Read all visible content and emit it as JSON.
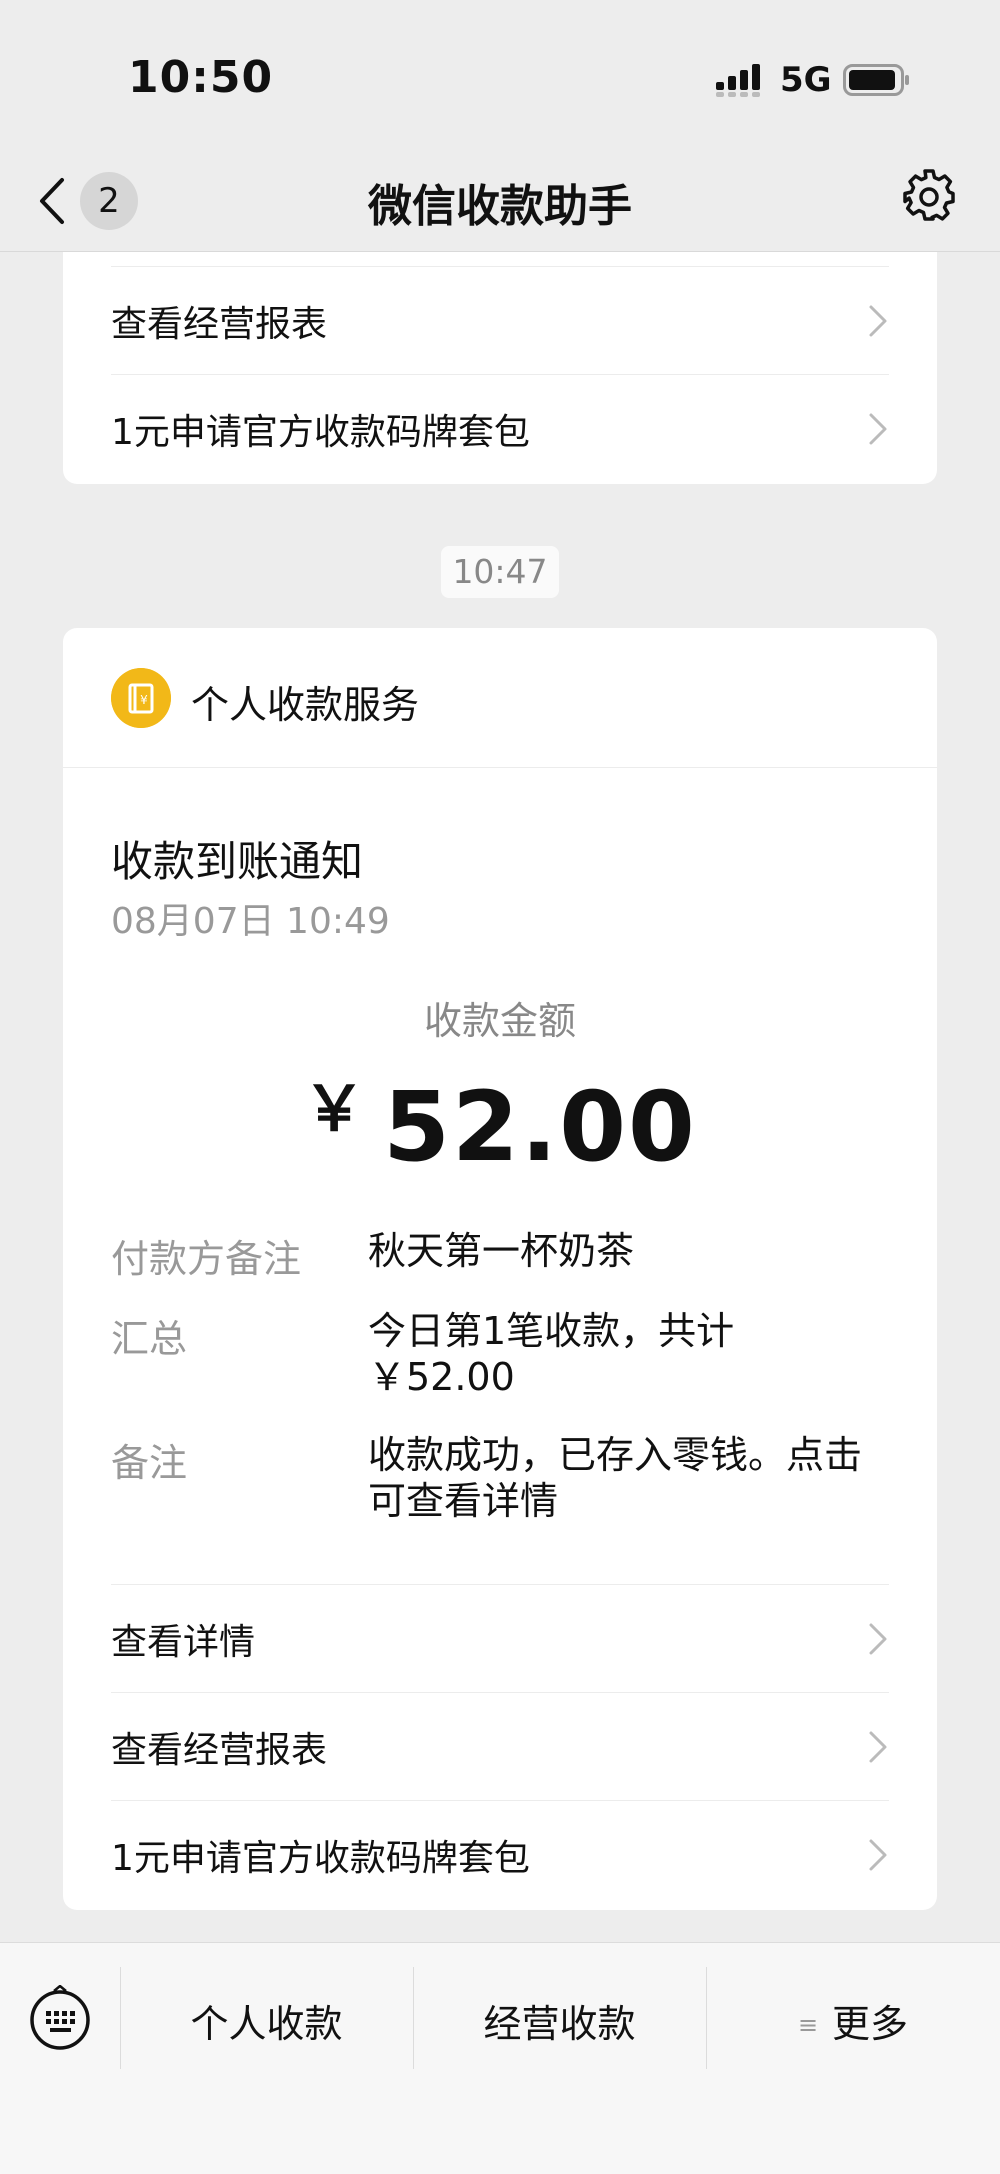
{
  "status_bar": {
    "time": "10:50",
    "network": "5G"
  },
  "nav": {
    "title": "微信收款助手",
    "unread_count": "2"
  },
  "top_card": {
    "rows": [
      {
        "label": "查看经营报表"
      },
      {
        "label": "1元申请官方收款码牌套包"
      }
    ]
  },
  "timestamp": "10:47",
  "service": {
    "name": "个人收款服务",
    "icon": "wallet-yen-icon"
  },
  "notification": {
    "title": "收款到账通知",
    "time": "08月07日 10:49",
    "amount_label": "收款金额",
    "currency": "￥",
    "amount": "52.00",
    "details": [
      {
        "key": "付款方备注",
        "value": "秋天第一杯奶茶"
      },
      {
        "key": "汇总",
        "value_line1": "今日第1笔收款，共计",
        "value_line2": "￥52.00"
      },
      {
        "key": "备注",
        "value_line1": "收款成功，已存入零钱。点击",
        "value_line2": "可查看详情"
      }
    ],
    "rows": [
      {
        "label": "查看详情"
      },
      {
        "label": "查看经营报表"
      },
      {
        "label": "1元申请官方收款码牌套包"
      }
    ]
  },
  "bottom_menu": {
    "items": [
      {
        "label": "个人收款"
      },
      {
        "label": "经营收款"
      },
      {
        "label": "更多",
        "icon": "menu-lines-icon"
      }
    ]
  },
  "colors": {
    "accent": "#f2b818",
    "background": "#ededed",
    "card": "#ffffff",
    "muted": "#999999"
  }
}
